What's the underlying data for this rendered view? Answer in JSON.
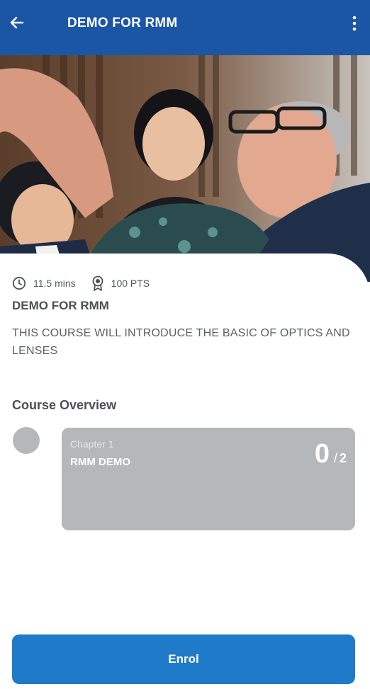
{
  "appbar": {
    "title": "DEMO FOR RMM",
    "back_icon": "arrow-left-icon",
    "more_icon": "more-vertical-icon"
  },
  "hero": {
    "description": "course-cover-image"
  },
  "course": {
    "duration": "11.5 mins",
    "points": "100 PTS",
    "title": "DEMO FOR RMM",
    "description": "THIS COURSE WILL INTRODUCE THE BASIC OF OPTICS AND LENSES"
  },
  "overview": {
    "heading": "Course Overview",
    "chapters": [
      {
        "label": "Chapter 1",
        "name": "RMM DEMO",
        "completed": "0",
        "separator": "/",
        "total": "2"
      }
    ]
  },
  "actions": {
    "enrol_label": "Enrol"
  },
  "colors": {
    "header": "#1b56a5",
    "button": "#1f7ac9",
    "chapter_card": "#b5b8bb",
    "text": "#4a5158"
  }
}
